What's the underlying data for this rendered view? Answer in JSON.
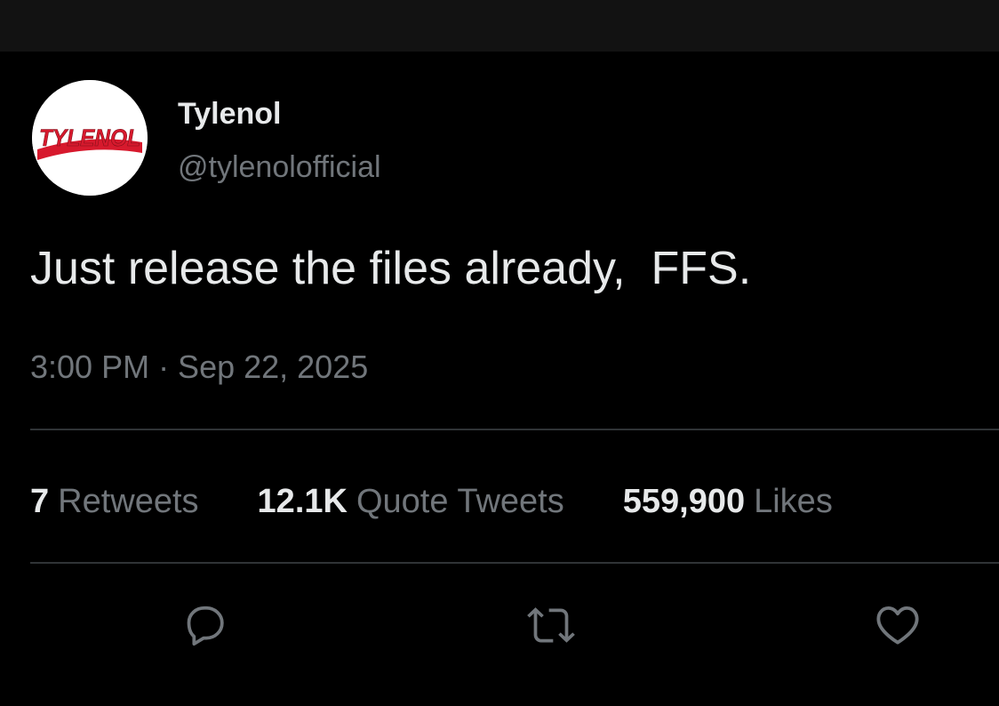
{
  "tweet": {
    "display_name": "Tylenol",
    "handle": "@tylenolofficial",
    "avatar_logo_text": "TYLENOL",
    "text": "Just release the files already,  FFS.",
    "timestamp": "3:00 PM · Sep 22, 2025",
    "stats": {
      "retweets_count": "7",
      "retweets_label": "Retweets",
      "quote_tweets_count": "12.1K",
      "quote_tweets_label": "Quote Tweets",
      "likes_count": "559,900",
      "likes_label": "Likes"
    },
    "actions": [
      {
        "icon": "reply-icon"
      },
      {
        "icon": "retweet-icon"
      },
      {
        "icon": "like-icon"
      }
    ]
  },
  "colors": {
    "background": "#000000",
    "top_bar": "#121212",
    "primary_text": "#e7e9ea",
    "secondary_text": "#71767b",
    "divider": "#2f3336",
    "brand_red": "#d7192d"
  }
}
